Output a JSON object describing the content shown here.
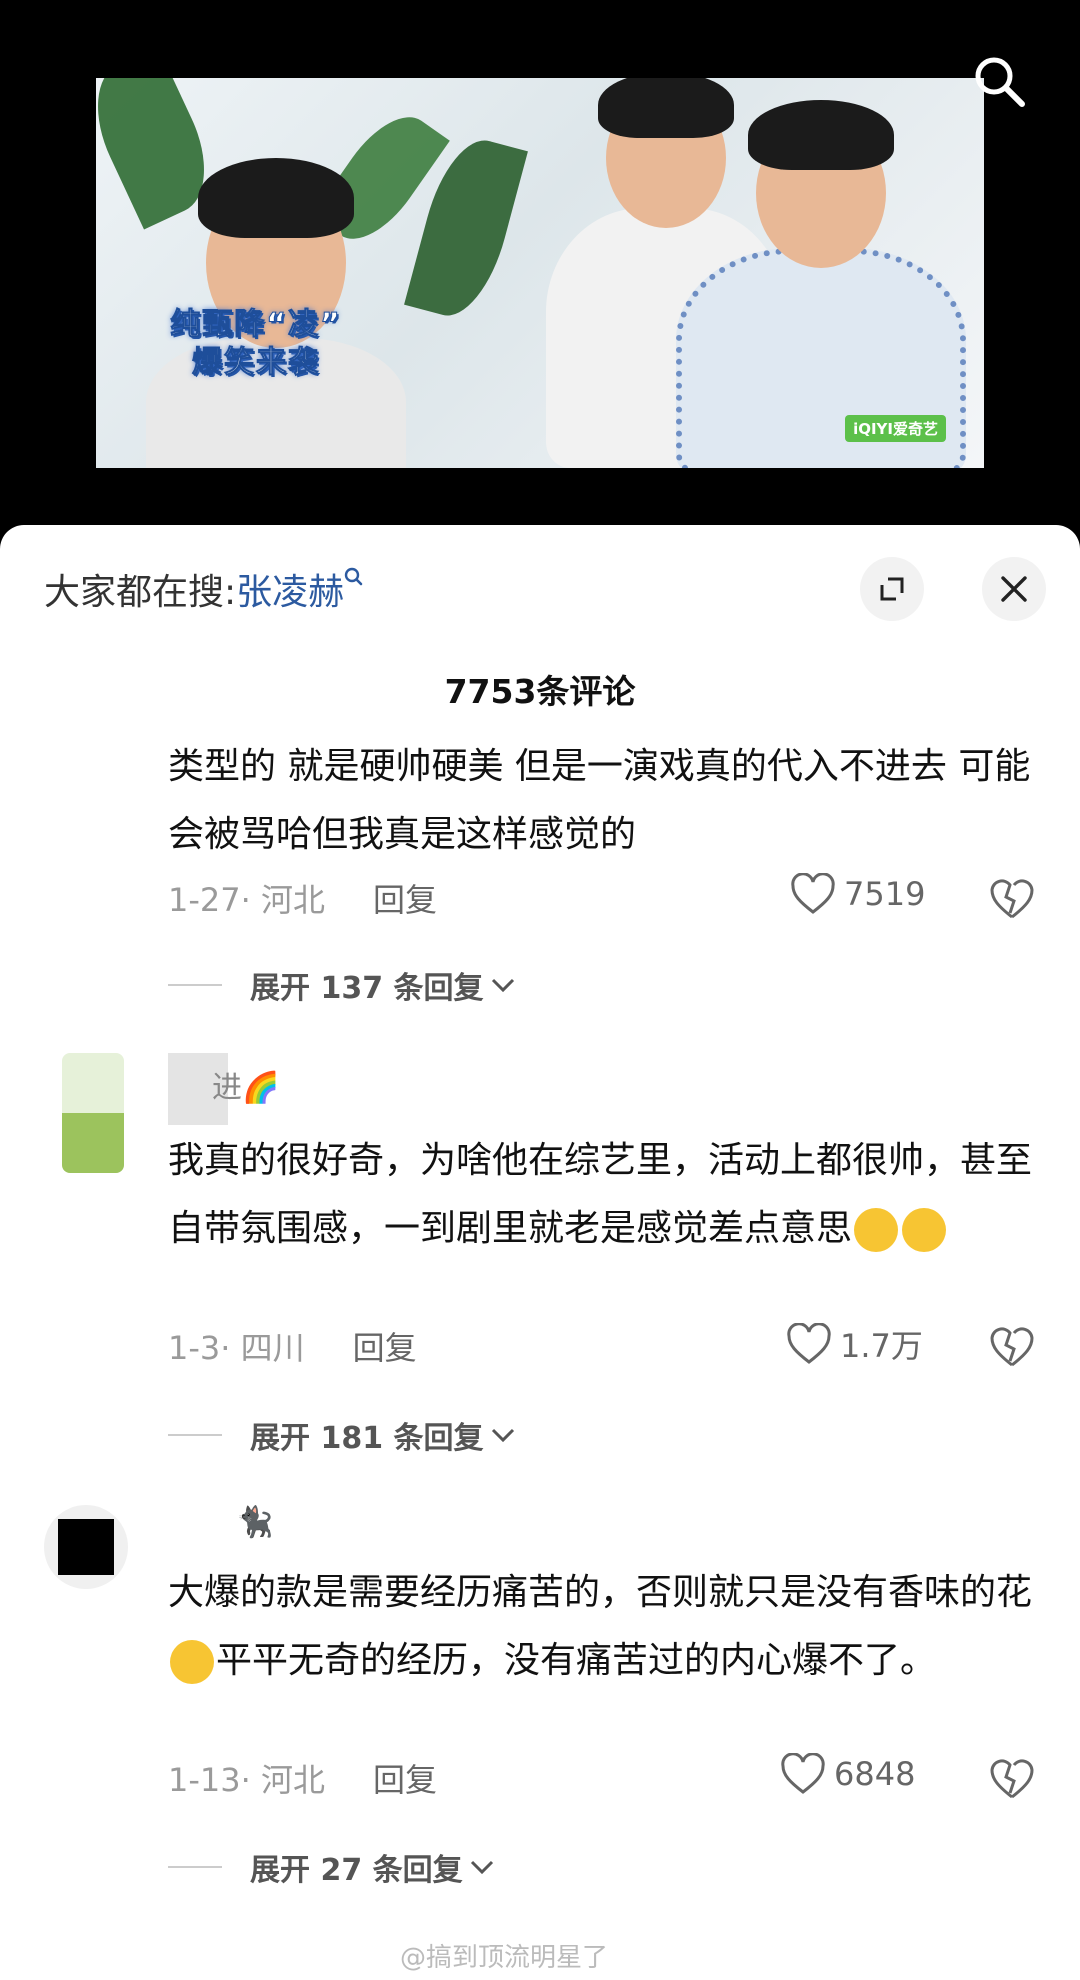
{
  "video": {
    "subtitle_line1": "纯甄降“凌”",
    "subtitle_line2": "爆笑来袭",
    "logo_text": "iQIYI爱奇艺"
  },
  "sheet": {
    "hot_search_label": "大家都在搜:",
    "hot_search_keyword": "张凌赫",
    "comment_count": "7753条评论"
  },
  "comments": [
    {
      "text": "类型的 就是硬帅硬美 但是一演戏真的代入不进去 可能会被骂哈但我真是这样感觉的",
      "date": "1-27",
      "location": "· 河北",
      "reply_label": "回复",
      "likes": "7519",
      "expand": "展开 137 条回复"
    },
    {
      "username": "进🌈",
      "text": "我真的很好奇，为啥他在综艺里，活动上都很帅，甚至自带氛围感，一到剧里就老是感觉差点意思",
      "date": "1-3",
      "location": "· 四川",
      "reply_label": "回复",
      "likes": "1.7万",
      "expand": "展开 181 条回复"
    },
    {
      "username": "🐈‍⬛",
      "text_part1": "大爆的款是需要经历痛苦的，否则就只是没有香味的花",
      "text_part2": "平平无奇的经历，没有痛苦过的内心爆不了。",
      "date": "1-13",
      "location": "· 河北",
      "reply_label": "回复",
      "likes": "6848",
      "expand": "展开 27 条回复"
    }
  ],
  "watermark": "@搞到顶流明星了",
  "icons": {
    "search": "search-icon",
    "expand": "expand-icon",
    "close": "close-icon",
    "like": "heart-icon",
    "dislike": "broken-heart-icon",
    "chevron": "chevron-down-icon"
  }
}
